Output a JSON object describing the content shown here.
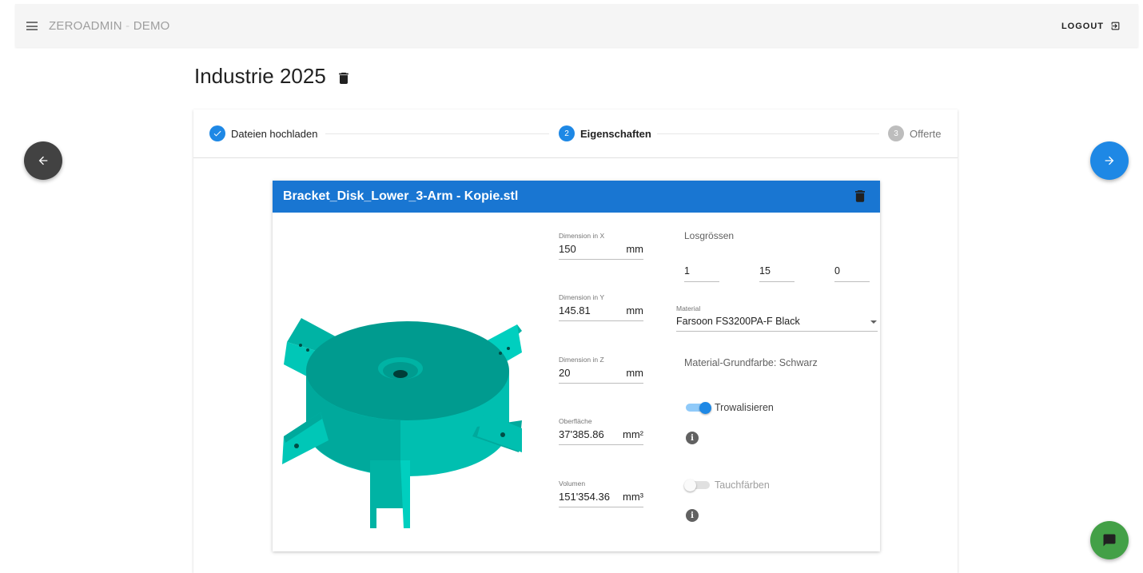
{
  "app": {
    "brand": "ZEROADMIN",
    "brand_sep": " - ",
    "brand_suffix": "DEMO",
    "logout_label": "LOGOUT"
  },
  "page": {
    "title": "Industrie 2025"
  },
  "stepper": {
    "steps": [
      {
        "number": "1",
        "label": "Dateien hochladen",
        "state": "complete"
      },
      {
        "number": "2",
        "label": "Eigenschaften",
        "state": "active"
      },
      {
        "number": "3",
        "label": "Offerte",
        "state": "inactive"
      }
    ]
  },
  "file": {
    "name": "Bracket_Disk_Lower_3-Arm - Kopie.stl",
    "model_color": "#009b8f",
    "dimensions": [
      {
        "label": "Dimension in X",
        "value": "150",
        "unit": "mm"
      },
      {
        "label": "Dimension in Y",
        "value": "145.81",
        "unit": "mm"
      },
      {
        "label": "Dimension in Z",
        "value": "20",
        "unit": "mm"
      },
      {
        "label": "Oberfläche",
        "value": "37'385.86",
        "unit": "mm²"
      },
      {
        "label": "Volumen",
        "value": "151'354.36",
        "unit": "mm³"
      }
    ],
    "losgroessen": {
      "label": "Losgrössen",
      "values": [
        "1",
        "15",
        "0"
      ]
    },
    "material": {
      "label": "Material",
      "value": "Farsoon FS3200PA-F Black"
    },
    "grundfarbe": "Material-Grundfarbe: Schwarz",
    "options": [
      {
        "label": "Trowalisieren",
        "enabled": true
      },
      {
        "label": "Tauchfärben",
        "enabled": false
      }
    ]
  },
  "colors": {
    "primary": "#1e88e5",
    "header": "#1976d2",
    "back_fab": "#424242",
    "chat_fab": "#43a047"
  }
}
